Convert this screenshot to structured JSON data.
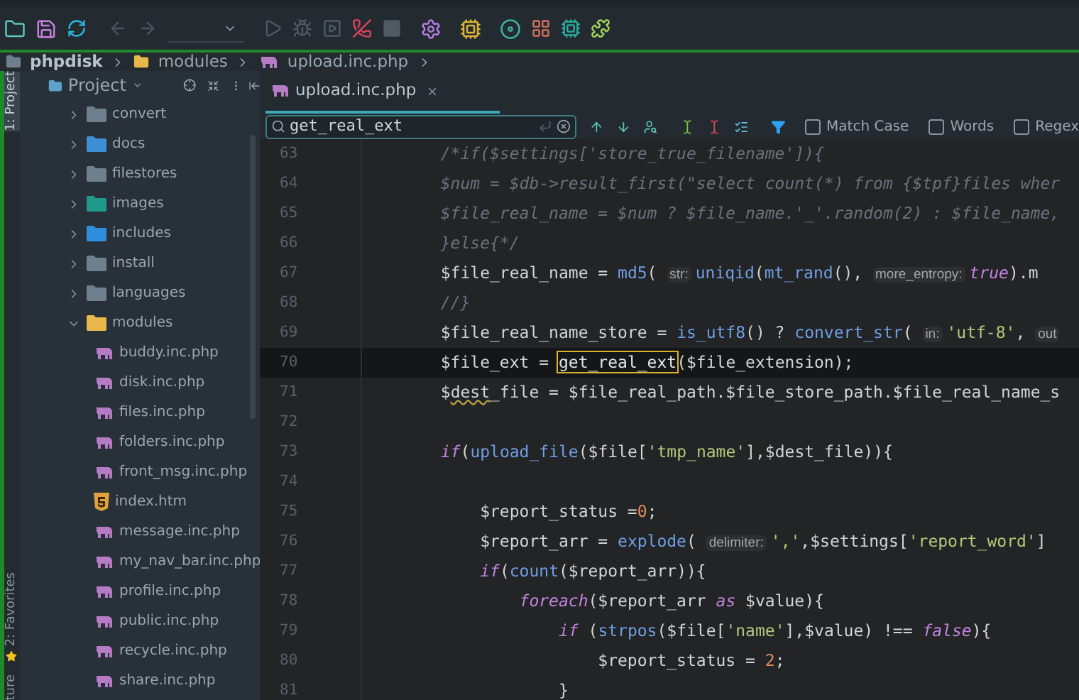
{
  "breadcrumb": [
    {
      "label": "phpdisk",
      "kind": "project"
    },
    {
      "label": "modules",
      "kind": "folder"
    },
    {
      "label": "upload.inc.php",
      "kind": "php"
    }
  ],
  "left_strip": {
    "top": [
      {
        "label": "1: Project",
        "selected": true
      }
    ],
    "bottom": [
      {
        "label": "2: Favorites",
        "kind": "favorites"
      },
      {
        "label": "ture",
        "kind": "plain"
      }
    ]
  },
  "project_panel": {
    "title": "Project",
    "tree": [
      {
        "label": "convert",
        "kind": "folder",
        "color": "#6e7f8d",
        "expanded": false
      },
      {
        "label": "docs",
        "kind": "folder",
        "color": "#3d8fd6",
        "expanded": false
      },
      {
        "label": "filestores",
        "kind": "folder",
        "color": "#6e7f8d",
        "expanded": false
      },
      {
        "label": "images",
        "kind": "folder",
        "color": "#1f9a8a",
        "expanded": false
      },
      {
        "label": "includes",
        "kind": "folder",
        "color": "#2f8fdf",
        "expanded": false
      },
      {
        "label": "install",
        "kind": "folder",
        "color": "#6e7f8d",
        "expanded": false
      },
      {
        "label": "languages",
        "kind": "folder",
        "color": "#6e7f8d",
        "expanded": false
      },
      {
        "label": "modules",
        "kind": "folder",
        "color": "#e8b84a",
        "expanded": true,
        "children": [
          {
            "label": "buddy.inc.php",
            "kind": "php"
          },
          {
            "label": "disk.inc.php",
            "kind": "php"
          },
          {
            "label": "files.inc.php",
            "kind": "php"
          },
          {
            "label": "folders.inc.php",
            "kind": "php"
          },
          {
            "label": "front_msg.inc.php",
            "kind": "php"
          },
          {
            "label": "index.htm",
            "kind": "html"
          },
          {
            "label": "message.inc.php",
            "kind": "php"
          },
          {
            "label": "my_nav_bar.inc.php",
            "kind": "php"
          },
          {
            "label": "profile.inc.php",
            "kind": "php"
          },
          {
            "label": "public.inc.php",
            "kind": "php"
          },
          {
            "label": "recycle.inc.php",
            "kind": "php"
          },
          {
            "label": "share.inc.php",
            "kind": "php"
          }
        ]
      }
    ]
  },
  "editor": {
    "tabs": [
      {
        "label": "upload.inc.php",
        "selected": true
      }
    ],
    "search": {
      "value": "get_real_ext",
      "options": [
        {
          "label": "Match Case",
          "checked": false
        },
        {
          "label": "Words",
          "checked": false
        },
        {
          "label": "Regex",
          "checked": false
        }
      ]
    },
    "lines": [
      {
        "number": "63",
        "current": false,
        "tokens": [
          {
            "kind": "comment",
            "text": "        /*if($settings['store_true_filename']){"
          }
        ]
      },
      {
        "number": "64",
        "current": false,
        "tokens": [
          {
            "kind": "comment",
            "text": "        $num = $db->result_first(\"select count(*) from {$tpf}files wher"
          }
        ]
      },
      {
        "number": "65",
        "current": false,
        "tokens": [
          {
            "kind": "comment",
            "text": "        $file_real_name = $num ? $file_name.'_'.random(2) : $file_name,"
          }
        ]
      },
      {
        "number": "66",
        "current": false,
        "tokens": [
          {
            "kind": "comment",
            "text": "        }else{*/"
          }
        ]
      },
      {
        "number": "67",
        "current": false,
        "tokens": [
          {
            "kind": "plain",
            "text": "        $file_real_name = "
          },
          {
            "kind": "func",
            "text": "md5"
          },
          {
            "kind": "plain",
            "text": "( "
          },
          {
            "kind": "hint",
            "text": "str:"
          },
          {
            "kind": "func",
            "text": "uniqid"
          },
          {
            "kind": "plain",
            "text": "("
          },
          {
            "kind": "func",
            "text": "mt_rand"
          },
          {
            "kind": "plain",
            "text": "(), "
          },
          {
            "kind": "hint",
            "text": "more_entropy:"
          },
          {
            "kind": "keyword",
            "text": "true"
          },
          {
            "kind": "plain",
            "text": ").m"
          }
        ]
      },
      {
        "number": "68",
        "current": false,
        "tokens": [
          {
            "kind": "comment",
            "text": "        //}"
          }
        ]
      },
      {
        "number": "69",
        "current": false,
        "tokens": [
          {
            "kind": "plain",
            "text": "        $file_real_name_store = "
          },
          {
            "kind": "func",
            "text": "is_utf8"
          },
          {
            "kind": "plain",
            "text": "() ? "
          },
          {
            "kind": "func",
            "text": "convert_str"
          },
          {
            "kind": "plain",
            "text": "( "
          },
          {
            "kind": "hint",
            "text": "in:"
          },
          {
            "kind": "string",
            "text": "'utf-8'"
          },
          {
            "kind": "plain",
            "text": ", "
          },
          {
            "kind": "hint",
            "text": "out"
          }
        ]
      },
      {
        "number": "70",
        "current": true,
        "tokens": [
          {
            "kind": "plain",
            "text": "        $file_ext = "
          },
          {
            "kind": "match",
            "text": "get_real_ext"
          },
          {
            "kind": "plain",
            "text": "($file_extension);"
          }
        ]
      },
      {
        "number": "71",
        "current": false,
        "tokens": [
          {
            "kind": "plain",
            "text": "        $"
          },
          {
            "kind": "typo",
            "text": "dest"
          },
          {
            "kind": "plain",
            "text": "_file = $file_real_path.$file_store_path.$file_real_name_s"
          }
        ]
      },
      {
        "number": "72",
        "current": false
      },
      {
        "number": "73",
        "current": false,
        "tokens": [
          {
            "kind": "keyword",
            "text": "        if"
          },
          {
            "kind": "plain",
            "text": "("
          },
          {
            "kind": "func",
            "text": "upload_file"
          },
          {
            "kind": "plain",
            "text": "($file["
          },
          {
            "kind": "string",
            "text": "'tmp_name'"
          },
          {
            "kind": "plain",
            "text": "],$dest_file)){"
          }
        ]
      },
      {
        "number": "74",
        "current": false
      },
      {
        "number": "75",
        "current": false,
        "tokens": [
          {
            "kind": "plain",
            "text": "            $report_status ="
          },
          {
            "kind": "number",
            "text": "0"
          },
          {
            "kind": "plain",
            "text": ";"
          }
        ]
      },
      {
        "number": "76",
        "current": false,
        "tokens": [
          {
            "kind": "plain",
            "text": "            $report_arr = "
          },
          {
            "kind": "func",
            "text": "explode"
          },
          {
            "kind": "plain",
            "text": "( "
          },
          {
            "kind": "hint",
            "text": "delimiter:"
          },
          {
            "kind": "string",
            "text": "','"
          },
          {
            "kind": "plain",
            "text": ",$settings["
          },
          {
            "kind": "string",
            "text": "'report_word'"
          },
          {
            "kind": "plain",
            "text": "]"
          }
        ]
      },
      {
        "number": "77",
        "current": false,
        "tokens": [
          {
            "kind": "keyword",
            "text": "            if"
          },
          {
            "kind": "plain",
            "text": "("
          },
          {
            "kind": "func",
            "text": "count"
          },
          {
            "kind": "plain",
            "text": "($report_arr)){"
          }
        ]
      },
      {
        "number": "78",
        "current": false,
        "tokens": [
          {
            "kind": "keyword",
            "text": "                foreach"
          },
          {
            "kind": "plain",
            "text": "($report_arr "
          },
          {
            "kind": "keyword",
            "text": "as"
          },
          {
            "kind": "plain",
            "text": " $value){"
          }
        ]
      },
      {
        "number": "79",
        "current": false,
        "tokens": [
          {
            "kind": "keyword",
            "text": "                    if"
          },
          {
            "kind": "plain",
            "text": " ("
          },
          {
            "kind": "func",
            "text": "strpos"
          },
          {
            "kind": "plain",
            "text": "($file["
          },
          {
            "kind": "string",
            "text": "'name'"
          },
          {
            "kind": "plain",
            "text": "],$value) !== "
          },
          {
            "kind": "keyword",
            "text": "false"
          },
          {
            "kind": "plain",
            "text": "){"
          }
        ]
      },
      {
        "number": "80",
        "current": false,
        "tokens": [
          {
            "kind": "plain",
            "text": "                        $report_status = "
          },
          {
            "kind": "number",
            "text": "2"
          },
          {
            "kind": "plain",
            "text": ";"
          }
        ]
      },
      {
        "number": "81",
        "current": false,
        "tokens": [
          {
            "kind": "plain",
            "text": "                    }"
          }
        ]
      }
    ]
  }
}
